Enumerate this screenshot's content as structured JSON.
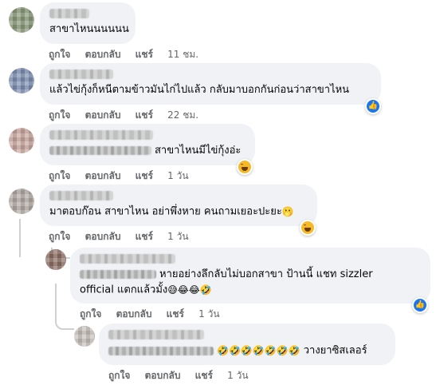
{
  "comments": [
    {
      "text": "สาขาไหนนนนนน",
      "like": "ถูกใจ",
      "reply": "ตอบกลับ",
      "share": "แชร์",
      "time": "11 ชม."
    },
    {
      "text": "แล้วไข่กุ้งก็หนีตามข้าวมันไก่ไปแล้ว กลับมาบอกกันก่อนว่าสาขาไหน",
      "like": "ถูกใจ",
      "reply": "ตอบกลับ",
      "share": "แชร์",
      "time": "22 ชม."
    },
    {
      "text": "สาขาไหนมีไข่กุ้งอ่ะ",
      "like": "ถูกใจ",
      "reply": "ตอบกลับ",
      "share": "แชร์",
      "time": "1 วัน"
    },
    {
      "text": "มาตอบก๊อน สาขาไหน อย่าพึ่งหาย คนถามเยอะปะยะ",
      "emoji": "🫢",
      "like": "ถูกใจ",
      "reply": "ตอบกลับ",
      "share": "แชร์",
      "time": "1 วัน"
    },
    {
      "text_line1": "หายอย่างลึกลับไม่บอกสาขา ป้านนี้ แชท sizzler",
      "text_line2": "official แตกแล้วมั้ง",
      "emoji": "😅😂😂🤣",
      "like": "ถูกใจ",
      "reply": "ตอบกลับ",
      "share": "แชร์",
      "time": "1 วัน"
    },
    {
      "emoji": "🤣🤣🤣🤣🤣🤣🤣",
      "text": "วางยาซิสเลอร์",
      "like": "ถูกใจ",
      "reply": "ตอบกลับ",
      "share": "แชร์",
      "time": "1 วัน"
    }
  ],
  "reactions": {
    "like_icon": "like-icon",
    "haha_icon": "haha-icon",
    "like_color": "#1877f2",
    "haha_color": "#f7b928"
  }
}
